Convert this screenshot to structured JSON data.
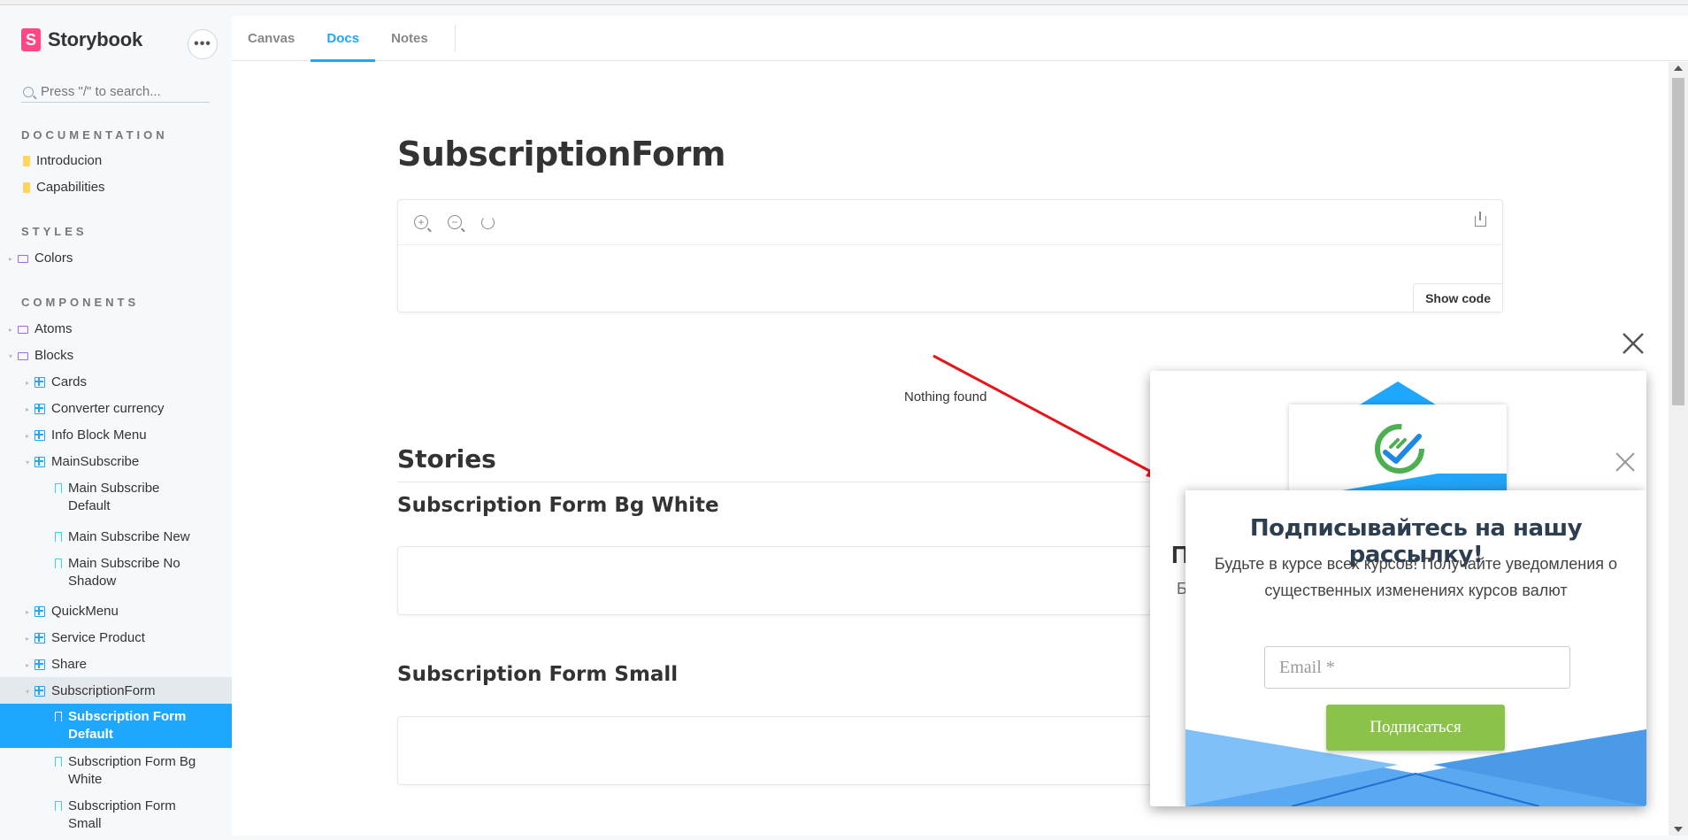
{
  "sidebar": {
    "brand": "Storybook",
    "brand_letter": "S",
    "more": "•••",
    "search_placeholder": "Press \"/\" to search...",
    "sections": {
      "documentation": "DOCUMENTATION",
      "styles": "STYLES",
      "components": "COMPONENTS"
    },
    "items": {
      "introducion": "Introducion",
      "capabilities": "Capabilities",
      "colors": "Colors",
      "atoms": "Atoms",
      "blocks": "Blocks",
      "cards": "Cards",
      "converter_currency": "Converter currency",
      "info_block_menu": "Info Block Menu",
      "main_subscribe": "MainSubscribe",
      "main_subscribe_default": "Main Subscribe Default",
      "main_subscribe_new": "Main Subscribe New",
      "main_subscribe_no_shadow": "Main Subscribe No Shadow",
      "quick_menu": "QuickMenu",
      "service_product": "Service Product",
      "share": "Share",
      "subscription_form": "SubscriptionForm",
      "subscription_form_default": "Subscription Form Default",
      "subscription_form_bg_white": "Subscription Form Bg White",
      "subscription_form_small": "Subscription Form Small"
    }
  },
  "tabs": {
    "canvas": "Canvas",
    "docs": "Docs",
    "notes": "Notes",
    "active": "Docs"
  },
  "docs": {
    "title": "SubscriptionForm",
    "show_code": "Show code",
    "nothing_found": "Nothing found",
    "stories_heading": "Stories",
    "story_1": "Subscription Form Bg White",
    "story_2": "Subscription Form Small"
  },
  "modal": {
    "ghost_title": "П",
    "ghost_text": "Б",
    "title": "Подписывайтесь на нашу рассылку!",
    "text": "Будьте в курсе всех курсов! Получайте уведомления о существенных изменениях курсов валют",
    "email_placeholder": "Email *",
    "button": "Подписаться"
  },
  "colors": {
    "accent": "#1ea7fd",
    "brand": "#ff4785",
    "button": "#8bc34a",
    "arrow": "#e8141b"
  }
}
